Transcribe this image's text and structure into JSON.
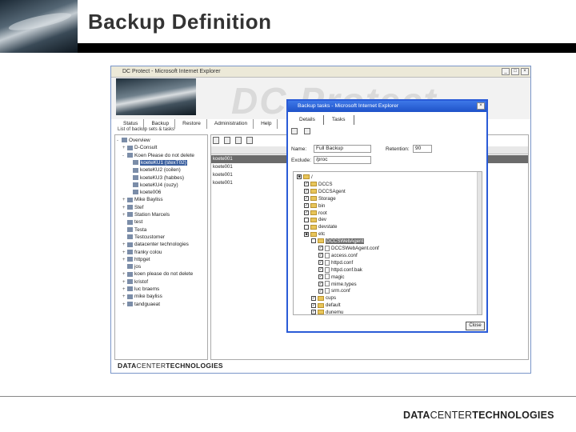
{
  "slide": {
    "title": "Backup Definition",
    "footer_logo_bold_left": "DATA",
    "footer_logo_thin": "CENTER",
    "footer_logo_bold_right": "TECHNOLOGIES"
  },
  "main_window": {
    "title": "DC Protect - Microsoft Internet Explorer",
    "banner_logo": "DC Protect",
    "tabs": [
      "Status",
      "Backup",
      "Restore",
      "Administration",
      "Help"
    ],
    "breadcrumb": "List of backup sets & tasks",
    "inner_logo_bold_left": "DATA",
    "inner_logo_thin": "CENTER",
    "inner_logo_bold_right": "TECHNOLOGIES"
  },
  "tree": [
    {
      "label": "Overview",
      "expander": "-"
    },
    {
      "label": "D-Consult",
      "expander": "+"
    },
    {
      "label": "Koen Please do not delete",
      "expander": "-"
    },
    {
      "label": "koeteKU1 (stexT02)",
      "expander": "",
      "selected": true
    },
    {
      "label": "koeteKU2 (coilen)",
      "expander": ""
    },
    {
      "label": "koeteKU3 (habbes)",
      "expander": ""
    },
    {
      "label": "koeteKU4 (ouzy)",
      "expander": ""
    },
    {
      "label": "koete006",
      "expander": ""
    },
    {
      "label": "Mike Bayliss",
      "expander": "+"
    },
    {
      "label": "Stef",
      "expander": "+"
    },
    {
      "label": "Station Marcels",
      "expander": "+"
    },
    {
      "label": "test",
      "expander": ""
    },
    {
      "label": "Testa",
      "expander": ""
    },
    {
      "label": "Testcustomer",
      "expander": ""
    },
    {
      "label": "datacenter technologies",
      "expander": "+"
    },
    {
      "label": "franky colou",
      "expander": "+"
    },
    {
      "label": "httpget",
      "expander": "+"
    },
    {
      "label": "jos",
      "expander": ""
    },
    {
      "label": "koen please do not delete",
      "expander": "+"
    },
    {
      "label": "kristof",
      "expander": "+"
    },
    {
      "label": "luc braems",
      "expander": "+"
    },
    {
      "label": "mike bayliss",
      "expander": "+"
    },
    {
      "label": "tandguaeat",
      "expander": "+"
    }
  ],
  "list": {
    "column_header": "A",
    "rows": [
      "koete001",
      "koete001",
      "koete001",
      "koete001"
    ]
  },
  "dialog": {
    "title": "Backup tasks - Microsoft Internet Explorer",
    "tabs": [
      "Details",
      "Tasks"
    ],
    "name_label": "Name:",
    "name_value": "Full Backup",
    "retention_label": "Retention:",
    "retention_value": "90",
    "exclude_label": "Exclude:",
    "exclude_value": "/proc",
    "close_label": "Close",
    "file_tree": [
      {
        "label": "/",
        "kind": "folder",
        "checked": "partial",
        "indent": 0
      },
      {
        "label": "DCCS",
        "kind": "folder",
        "checked": "yes",
        "indent": 1
      },
      {
        "label": "DCCSAgent",
        "kind": "folder",
        "checked": "yes",
        "indent": 1
      },
      {
        "label": "Storage",
        "kind": "folder",
        "checked": "yes",
        "indent": 1
      },
      {
        "label": "bin",
        "kind": "folder",
        "checked": "yes",
        "indent": 1
      },
      {
        "label": "root",
        "kind": "folder",
        "checked": "yes",
        "indent": 1
      },
      {
        "label": "dev",
        "kind": "folder",
        "checked": "no",
        "indent": 1
      },
      {
        "label": "devstate",
        "kind": "folder",
        "checked": "no",
        "indent": 1
      },
      {
        "label": "etc",
        "kind": "folder",
        "checked": "partial",
        "indent": 1
      },
      {
        "label": "DCCSWebAgent",
        "kind": "folder",
        "checked": "no",
        "indent": 2,
        "selected": true
      },
      {
        "label": "DCCSWebAgent.conf",
        "kind": "file",
        "checked": "yes",
        "indent": 3
      },
      {
        "label": "access.conf",
        "kind": "file",
        "checked": "yes",
        "indent": 3
      },
      {
        "label": "httpd.conf",
        "kind": "file",
        "checked": "yes",
        "indent": 3
      },
      {
        "label": "httpd.conf.bak",
        "kind": "file",
        "checked": "yes",
        "indent": 3
      },
      {
        "label": "magic",
        "kind": "file",
        "checked": "yes",
        "indent": 3
      },
      {
        "label": "mime.types",
        "kind": "file",
        "checked": "yes",
        "indent": 3
      },
      {
        "label": "srm.conf",
        "kind": "file",
        "checked": "yes",
        "indent": 3
      },
      {
        "label": "cups",
        "kind": "folder",
        "checked": "yes",
        "indent": 2
      },
      {
        "label": "default",
        "kind": "folder",
        "checked": "yes",
        "indent": 2
      },
      {
        "label": "dunemu",
        "kind": "folder",
        "checked": "yes",
        "indent": 2
      }
    ]
  }
}
